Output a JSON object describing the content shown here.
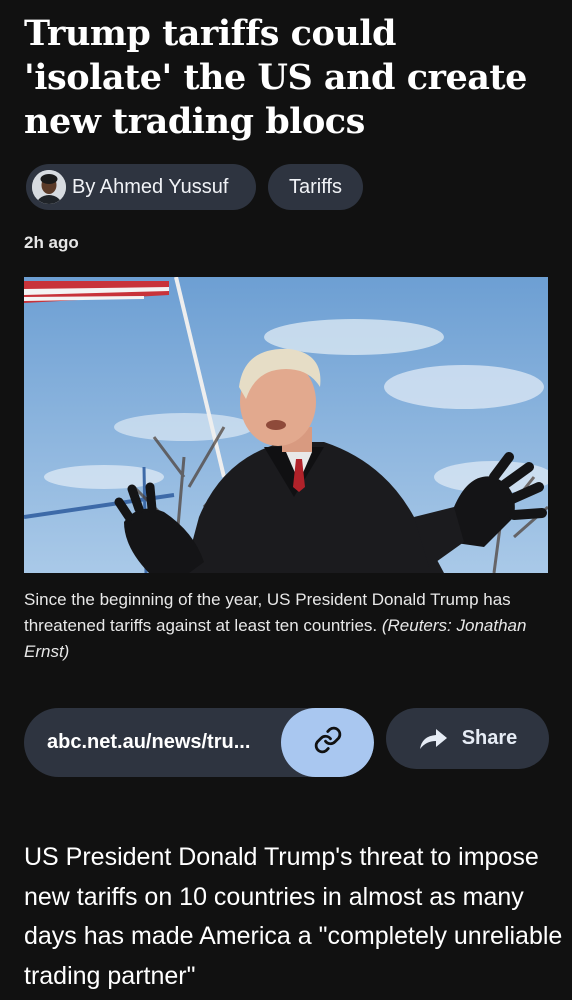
{
  "article": {
    "headline": "Trump tariffs could 'isolate' the US and create new trading blocs",
    "author_label": "By Ahmed Yussuf",
    "topic_tag": "Tariffs",
    "timestamp": "2h ago",
    "caption_text": "Since the beginning of the year, US President Donald Trump has threatened tariffs against at least ten countries. ",
    "caption_credit": "(Reuters: Jonathan Ernst)",
    "body_text": "US President Donald Trump's threat to impose new tariffs on 10 countries in almost as many days has made America a \"completely unreliable trading partner\""
  },
  "actions": {
    "url_text": "abc.net.au/news/tru...",
    "share_label": "Share"
  },
  "icons": {
    "copy_link": "link-icon",
    "share": "share-arrow-icon",
    "avatar": "author-avatar"
  },
  "colors": {
    "background": "#111111",
    "chip_background": "#2e3440",
    "link_button": "#a9c7f0",
    "text": "#ffffff"
  }
}
